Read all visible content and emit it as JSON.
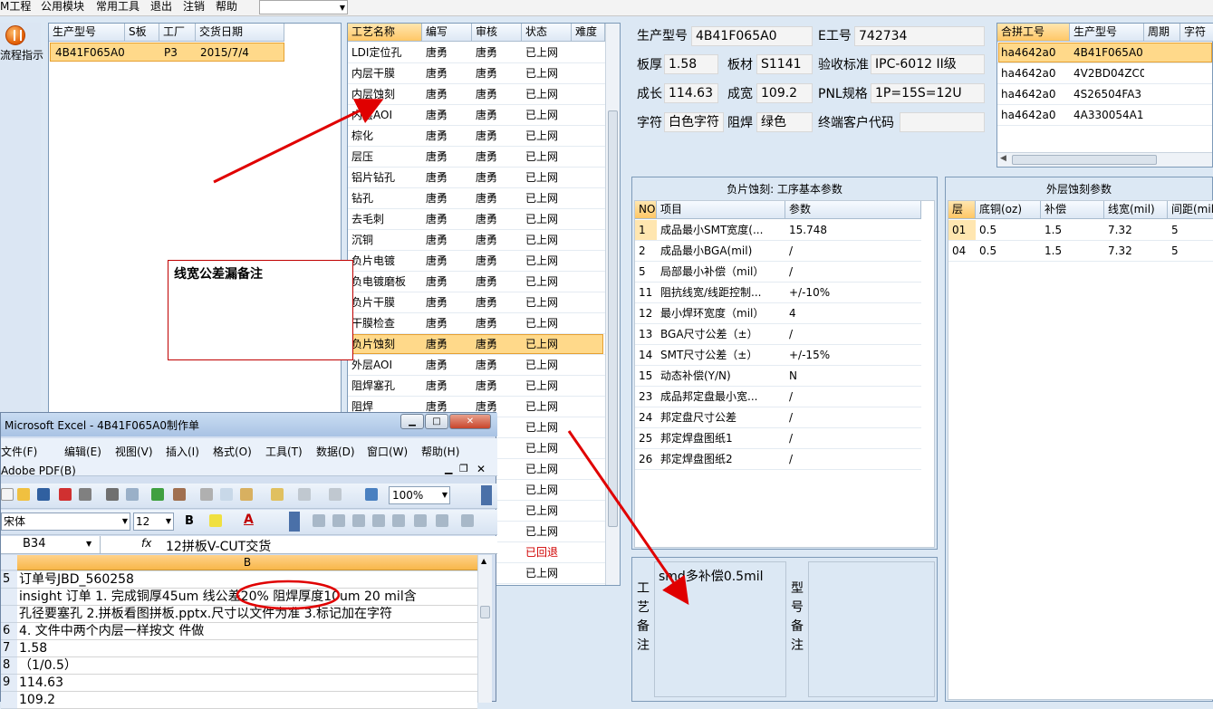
{
  "menu": {
    "items": [
      "M工程",
      "公用模块",
      "常用工具",
      "退出",
      "注销",
      "帮助"
    ]
  },
  "left_strip": {
    "button_label": "流程指示"
  },
  "model_grid": {
    "headers": [
      "生产型号",
      "S板",
      "工厂",
      "交货日期"
    ],
    "rows": [
      {
        "model": "4B41F065A0",
        "s": "",
        "factory": "P3",
        "date": "2015/7/4"
      }
    ]
  },
  "process_grid": {
    "headers": [
      "工艺名称",
      "编写",
      "审核",
      "状态",
      "难度"
    ],
    "rows": [
      [
        "LDI定位孔",
        "唐勇",
        "唐勇",
        "已上网"
      ],
      [
        "内层干膜",
        "唐勇",
        "唐勇",
        "已上网"
      ],
      [
        "内层蚀刻",
        "唐勇",
        "唐勇",
        "已上网"
      ],
      [
        "内层AOI",
        "唐勇",
        "唐勇",
        "已上网"
      ],
      [
        "棕化",
        "唐勇",
        "唐勇",
        "已上网"
      ],
      [
        "层压",
        "唐勇",
        "唐勇",
        "已上网"
      ],
      [
        "铝片钻孔",
        "唐勇",
        "唐勇",
        "已上网"
      ],
      [
        "钻孔",
        "唐勇",
        "唐勇",
        "已上网"
      ],
      [
        "去毛刺",
        "唐勇",
        "唐勇",
        "已上网"
      ],
      [
        "沉铜",
        "唐勇",
        "唐勇",
        "已上网"
      ],
      [
        "负片电镀",
        "唐勇",
        "唐勇",
        "已上网"
      ],
      [
        "负电镀磨板",
        "唐勇",
        "唐勇",
        "已上网"
      ],
      [
        "负片干膜",
        "唐勇",
        "唐勇",
        "已上网"
      ],
      [
        "干膜检查",
        "唐勇",
        "唐勇",
        "已上网"
      ],
      [
        "负片蚀刻",
        "唐勇",
        "唐勇",
        "已上网"
      ],
      [
        "外层AOI",
        "唐勇",
        "唐勇",
        "已上网"
      ],
      [
        "阻焊塞孔",
        "唐勇",
        "唐勇",
        "已上网"
      ],
      [
        "阻焊",
        "唐勇",
        "唐勇",
        "已上网"
      ],
      [
        "",
        "",
        "",
        "已上网"
      ],
      [
        "",
        "",
        "",
        "已上网"
      ],
      [
        "",
        "",
        "",
        "已上网"
      ],
      [
        "",
        "",
        "",
        "已上网"
      ],
      [
        "",
        "",
        "",
        "已上网"
      ],
      [
        "",
        "",
        "",
        "已上网"
      ],
      [
        "",
        "",
        "",
        "已回退"
      ],
      [
        "",
        "",
        "",
        "已上网"
      ]
    ],
    "selected_index": 14,
    "returned_color": "#d00000"
  },
  "info": {
    "model_label": "生产型号",
    "model_value": "4B41F065A0",
    "eng_label": "E工号",
    "eng_value": "742734",
    "thick_label": "板厚",
    "thick_value": "1.58",
    "material_label": "板材",
    "material_value": "S1141",
    "std_label": "验收标准",
    "std_value": "IPC-6012 II级",
    "len_label": "成长",
    "len_value": "114.63",
    "wid_label": "成宽",
    "wid_value": "109.2",
    "pnl_label": "PNL规格",
    "pnl_value": "1P=15S=12U",
    "char_label": "字符",
    "char_value": "白色字符",
    "mask_label": "阻焊",
    "mask_value": "绿色",
    "cust_label": "终端客户代码",
    "cust_value": ""
  },
  "combo_grid": {
    "headers": [
      "合拼工号",
      "生产型号",
      "周期",
      "字符"
    ],
    "rows": [
      [
        "ha4642a0",
        "4B41F065A0"
      ],
      [
        "ha4642a0",
        "4V2BD04ZC0"
      ],
      [
        "ha4642a0",
        "4S26504FA3"
      ],
      [
        "ha4642a0",
        "4A330054A1"
      ]
    ]
  },
  "neg_etch": {
    "title": "负片蚀刻: 工序基本参数",
    "headers": [
      "NO",
      "项目",
      "参数"
    ],
    "rows": [
      [
        "1",
        "成品最小SMT宽度(...",
        "15.748"
      ],
      [
        "2",
        "成品最小BGA(mil)",
        "/"
      ],
      [
        "5",
        "局部最小补偿（mil）",
        "/"
      ],
      [
        "11",
        "阻抗线宽/线距控制...",
        "+/-10%"
      ],
      [
        "12",
        "最小焊环宽度（mil）",
        "4"
      ],
      [
        "13",
        "BGA尺寸公差（±）",
        "/"
      ],
      [
        "14",
        "SMT尺寸公差（±）",
        "+/-15%"
      ],
      [
        "15",
        "动态补偿(Y/N)",
        "N"
      ],
      [
        "23",
        "成品邦定盘最小宽...",
        "/"
      ],
      [
        "24",
        "邦定盘尺寸公差",
        "/"
      ],
      [
        "25",
        "邦定焊盘图纸1",
        "/"
      ],
      [
        "26",
        "邦定焊盘图纸2",
        "/"
      ]
    ]
  },
  "outer_etch": {
    "title": "外层蚀刻参数",
    "headers": [
      "层",
      "底铜(oz)",
      "补偿",
      "线宽(mil)",
      "间距(mil"
    ],
    "rows": [
      [
        "01",
        "0.5",
        "1.5",
        "7.32",
        "5"
      ],
      [
        "04",
        "0.5",
        "1.5",
        "7.32",
        "5"
      ]
    ]
  },
  "notes": {
    "process_label": "工艺备注",
    "process_text": "smd多补偿0.5mil",
    "model_label": "型号备注"
  },
  "annotation": {
    "text": "线宽公差漏备注"
  },
  "excel": {
    "title": "Microsoft Excel - 4B41F065A0制作单",
    "menu": [
      "文件(F)",
      "编辑(E)",
      "视图(V)",
      "插入(I)",
      "格式(O)",
      "工具(T)",
      "数据(D)",
      "窗口(W)",
      "帮助(H)"
    ],
    "adobe": "Adobe PDF(B)",
    "zoom": "100%",
    "font": "宋体",
    "font_size": "12",
    "cell_ref": "B34",
    "fx": "fx",
    "formula": "12拼板V-CUT交货",
    "col_header": "B",
    "rows": [
      {
        "num": "5",
        "text": "订单号JBD_560258"
      },
      {
        "num": "",
        "text": "insight 订单  1. 完成铜厚45um  线公差20%  阻焊厚度10um 20 mil含"
      },
      {
        "num": "",
        "text": "孔径要塞孔    2.拼板看图拼板.pptx.尺寸以文件为准  3.标记加在字符"
      },
      {
        "num": "6",
        "text": "4.  文件中两个内层一样按文  件做"
      },
      {
        "num": "7",
        "text": "1.58"
      },
      {
        "num": "8",
        "text": "（1/0.5）"
      },
      {
        "num": "9",
        "text": "114.63"
      },
      {
        "num": "",
        "text": "109.2"
      }
    ]
  },
  "colors": {
    "selection": "#ffd98a",
    "accent_red": "#e00000",
    "header_grad": "#dde8f4"
  }
}
